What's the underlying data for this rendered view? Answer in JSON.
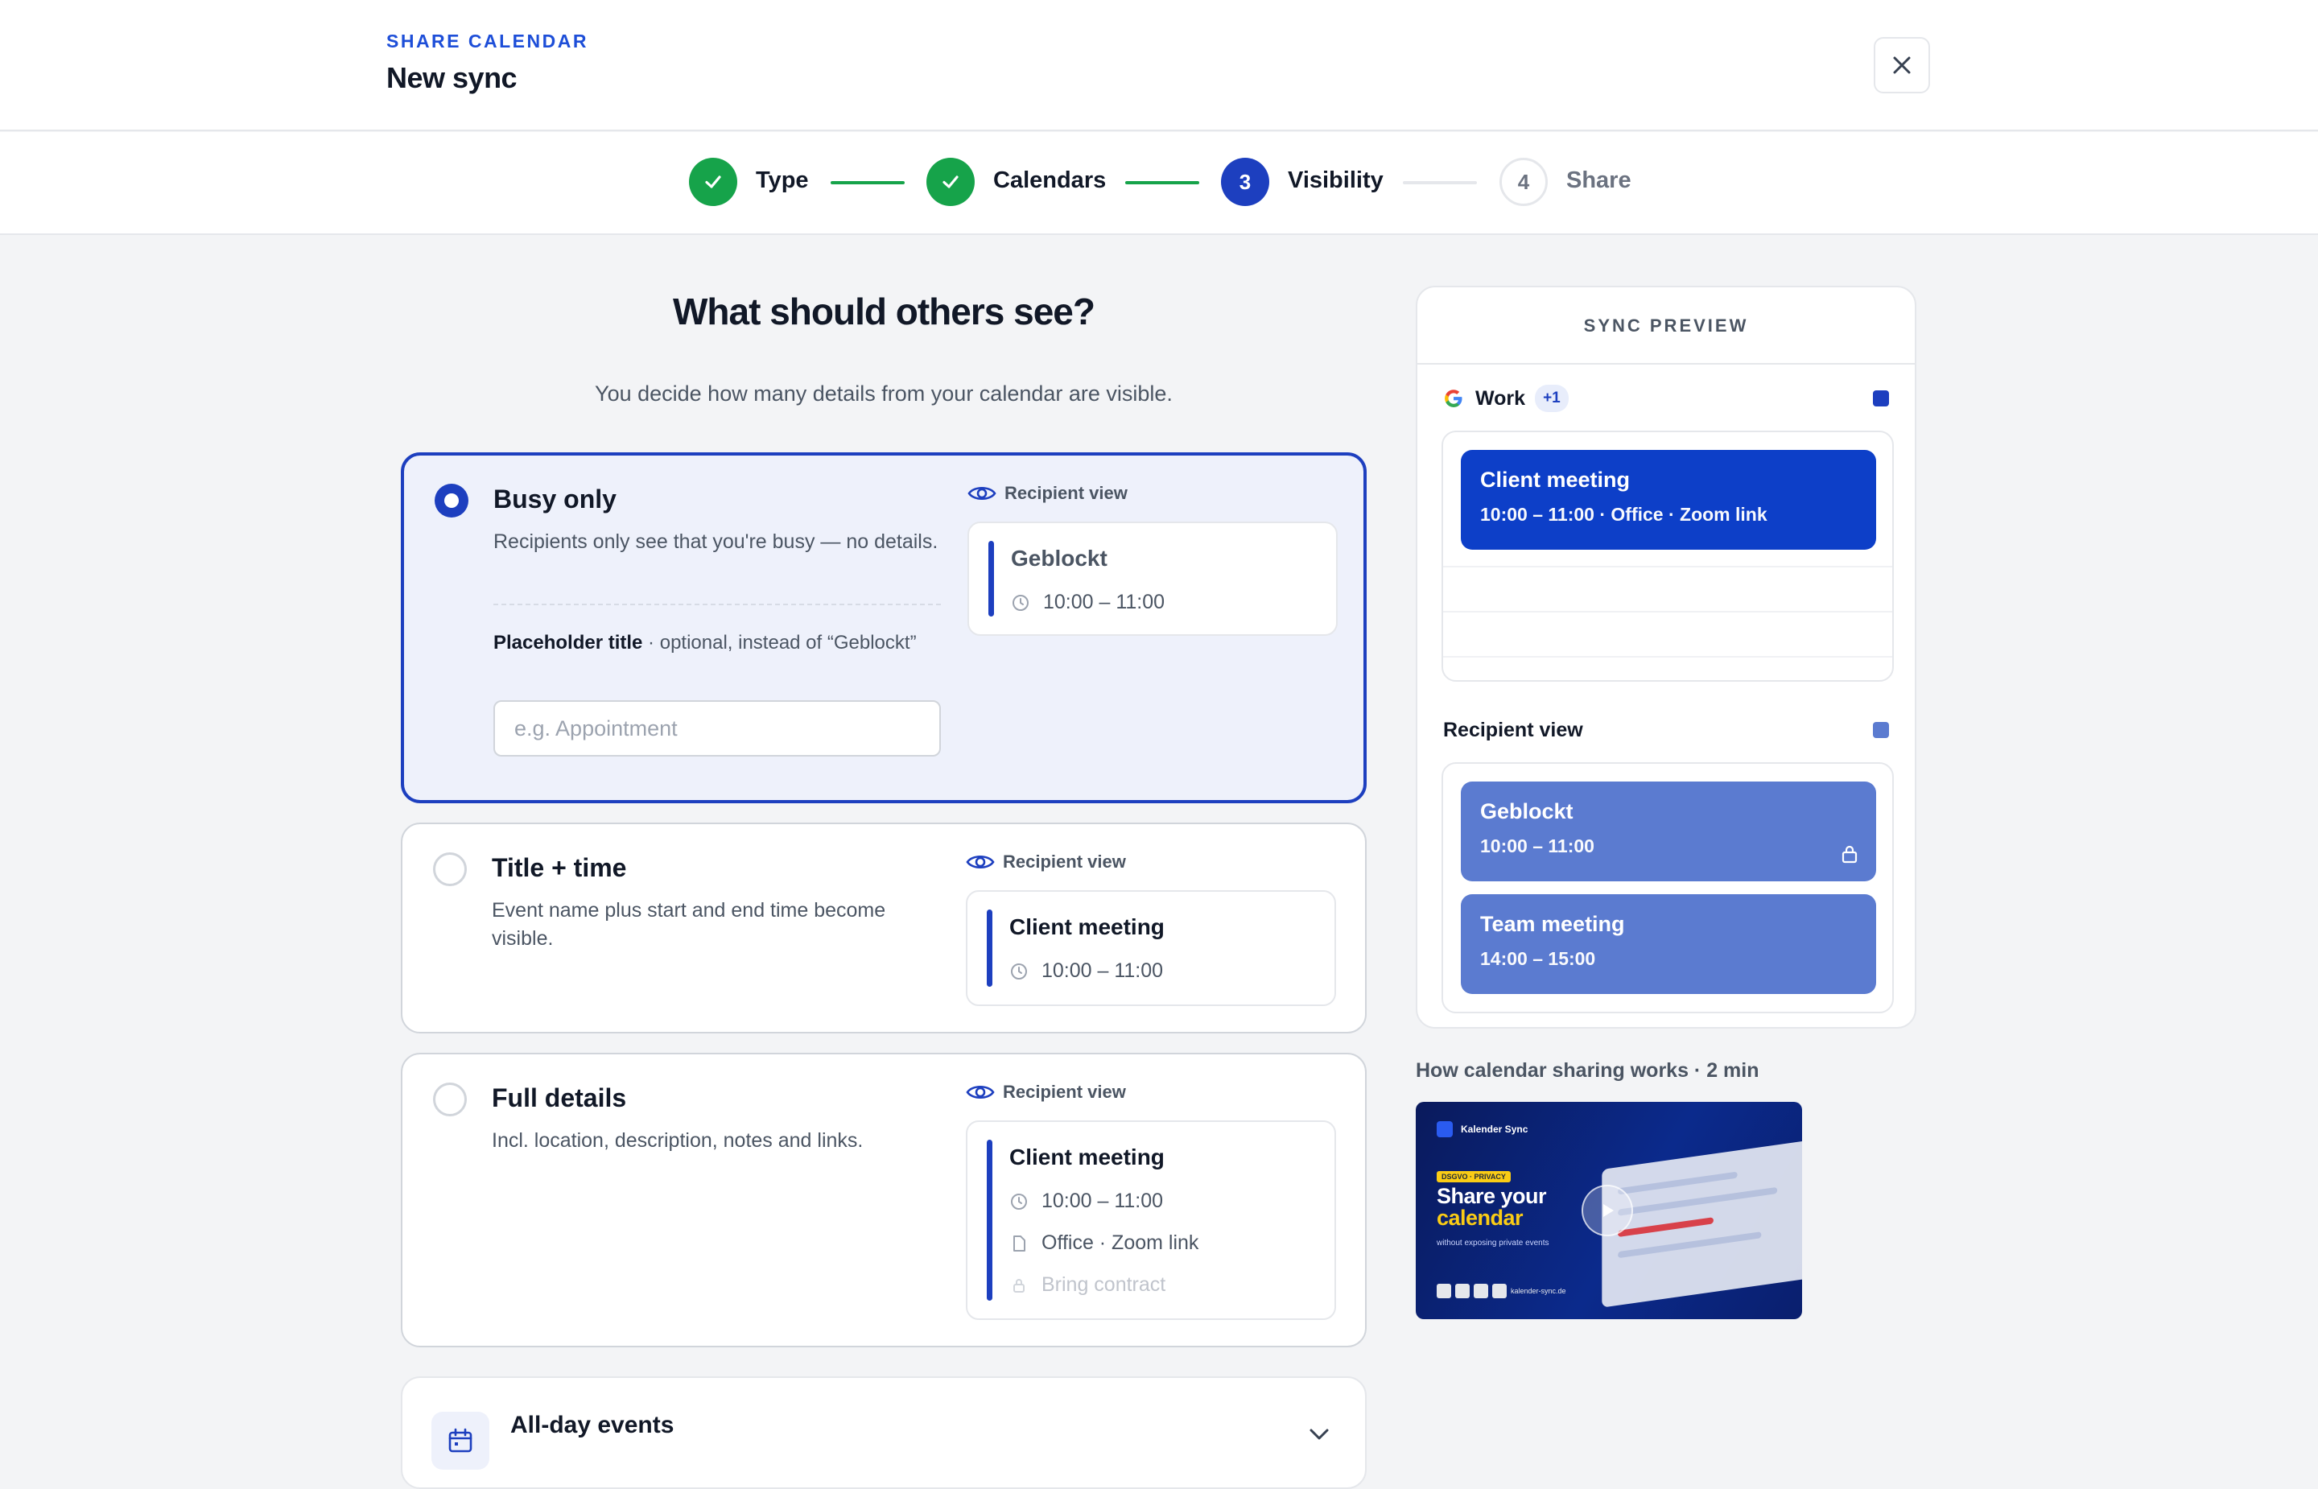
{
  "header": {
    "kicker": "SHARE CALENDAR",
    "title": "New sync",
    "close_icon": "close-icon"
  },
  "stepper": {
    "steps": [
      {
        "label": "Type",
        "status": "done"
      },
      {
        "label": "Calendars",
        "status": "done"
      },
      {
        "label": "Visibility",
        "status": "active",
        "number": "3"
      },
      {
        "label": "Share",
        "status": "todo",
        "number": "4"
      }
    ]
  },
  "main": {
    "heading": "What should others see?",
    "subheading": "You decide how many details from your calendar are visible.",
    "recipient_view_label": "Recipient view",
    "options": [
      {
        "title": "Busy only",
        "description": "Recipients only see that you're busy — no details.",
        "selected": true,
        "placeholder_label": "Placeholder title",
        "placeholder_hint": " · optional, instead of “Geblockt”",
        "placeholder_input": "e.g. Appointment",
        "preview": {
          "title": "Geblockt",
          "time": "10:00 – 11:00"
        }
      },
      {
        "title": "Title + time",
        "description": "Event name plus start and end time become visible.",
        "selected": false,
        "preview": {
          "title": "Client meeting",
          "time": "10:00 – 11:00"
        }
      },
      {
        "title": "Full details",
        "description": "Incl. location, description, notes and links.",
        "selected": false,
        "preview": {
          "title": "Client meeting",
          "time": "10:00 – 11:00",
          "location": "Office · Zoom link",
          "note": "Bring contract"
        }
      }
    ],
    "allday": {
      "title": "All-day events"
    }
  },
  "sync_preview": {
    "heading": "SYNC PREVIEW",
    "source": {
      "name": "Work",
      "badge": "+1",
      "icon": "google-icon",
      "color": "#1d3fbf"
    },
    "source_event": {
      "title": "Client meeting",
      "detail": "10:00 – 11:00 · Office · Zoom link"
    },
    "recipient_label": "Recipient view",
    "recipient_color": "#5b7bd0",
    "recipient_events": [
      {
        "title": "Geblockt",
        "time": "10:00 – 11:00",
        "icon": "lock-icon"
      },
      {
        "title": "Team meeting",
        "time": "14:00 – 15:00"
      }
    ]
  },
  "video": {
    "caption": "How calendar sharing works · 2 min",
    "brand": "Kalender Sync",
    "tag": "DSGVO · PRIVACY",
    "headline_1": "Share your",
    "headline_2": "calendar",
    "subline": "without exposing private events",
    "domain": "kalender-sync.de"
  },
  "colors": {
    "accent": "#1d3fbf",
    "success": "#16a34a",
    "event_dark": "#0d3fc8",
    "event_light": "#5b7bd0"
  }
}
